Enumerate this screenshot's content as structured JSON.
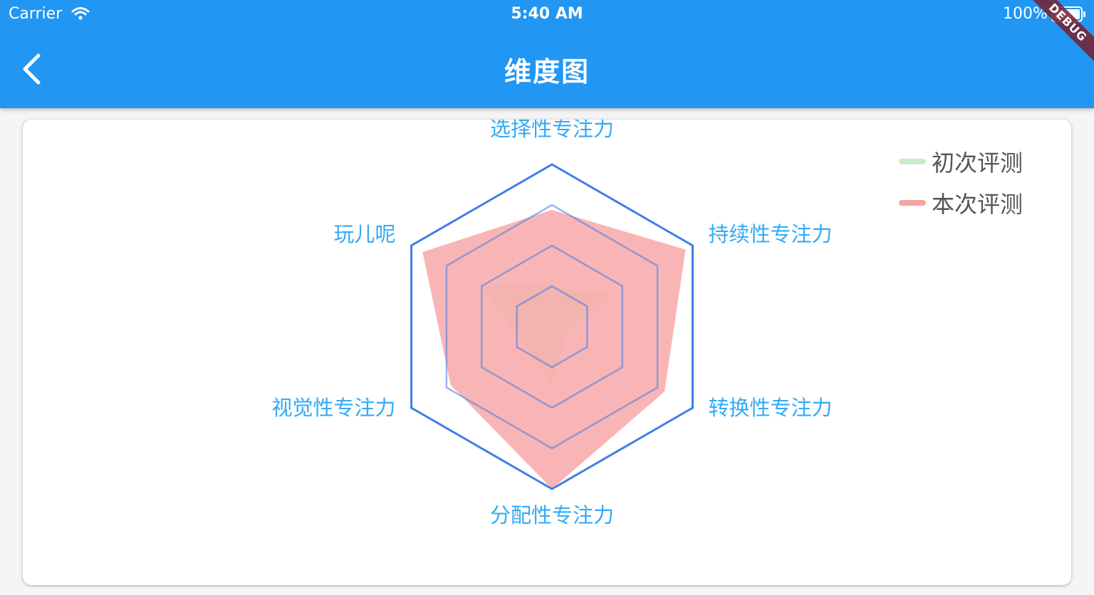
{
  "status_bar": {
    "carrier": "Carrier",
    "time": "5:40 AM",
    "battery": "100%"
  },
  "app_bar": {
    "title": "维度图",
    "back_icon": "chevron-left-icon",
    "color": "#2196f3"
  },
  "debug_banner": "DEBUG",
  "chart_data": {
    "type": "radar",
    "axes": [
      "选择性专注力",
      "持续性专注力",
      "转换性专注力",
      "分配性专注力",
      "视觉性专注力",
      "玩儿呢"
    ],
    "levels": 4,
    "max": 100,
    "series": [
      {
        "name": "初次评测",
        "color": "#c8ebc8",
        "values": [
          25,
          40,
          10,
          35,
          20,
          50
        ]
      },
      {
        "name": "本次评测",
        "color": "#f7a3a3",
        "values": [
          72,
          95,
          80,
          100,
          72,
          92
        ]
      }
    ],
    "grid_color": "#3f7ee8",
    "label_color": "#33aaf5",
    "legend_position": "top-right"
  }
}
